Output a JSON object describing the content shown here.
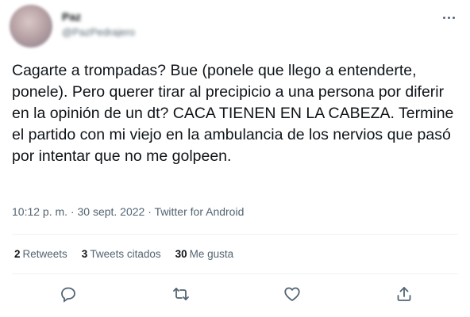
{
  "author": {
    "display_name": "Paz",
    "handle": "@PazPedrajero"
  },
  "tweet": {
    "text": "Cagarte a trompadas? Bue (ponele que llego a entenderte, ponele). Pero querer tirar al precipicio a una persona por diferir en la opinión de un dt? CACA TIENEN EN LA CABEZA. Termine el partido con mi viejo en la ambulancia de los nervios que pasó por intentar que no me golpeen.",
    "timestamp": "10:12 p. m. · 30 sept. 2022 · ",
    "source": "Twitter for Android"
  },
  "stats": {
    "retweets_count": "2",
    "retweets_label": "Retweets",
    "quotes_count": "3",
    "quotes_label": "Tweets citados",
    "likes_count": "30",
    "likes_label": "Me gusta"
  },
  "icons": {
    "more": "more-horizontal-icon",
    "reply": "reply-icon",
    "retweet": "retweet-icon",
    "like": "heart-icon",
    "share": "share-icon"
  },
  "colors": {
    "text": "#0f1419",
    "secondary": "#536471",
    "divider": "#eff3f4"
  }
}
